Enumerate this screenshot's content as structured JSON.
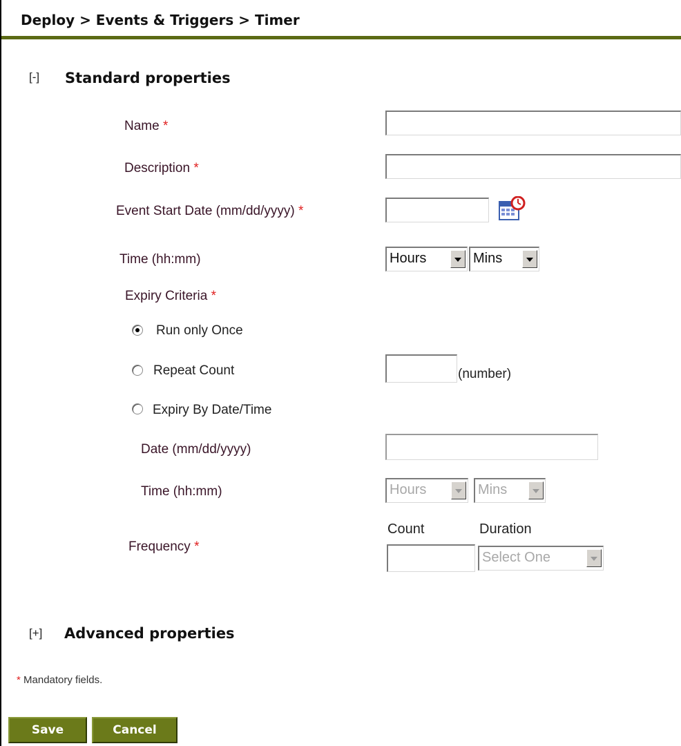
{
  "breadcrumb": "Deploy > Events & Triggers > Timer",
  "standard": {
    "toggle": "[-]",
    "title": "Standard properties",
    "name_label": "Name",
    "description_label": "Description",
    "start_date_label": "Event Start Date (mm/dd/yyyy)",
    "time_label": "Time  (hh:mm)",
    "hours_value": "Hours",
    "mins_value": "Mins",
    "expiry_label": "Expiry Criteria",
    "run_once_label": "Run only Once",
    "repeat_count_label": "Repeat Count",
    "number_hint": "(number)",
    "expiry_date_label": "Expiry By Date/Time",
    "date_label": "Date (mm/dd/yyyy)",
    "time2_label": "Time (hh:mm)",
    "hours2_value": "Hours",
    "mins2_value": "Mins",
    "count_header": "Count",
    "duration_header": "Duration",
    "frequency_label": "Frequency",
    "duration_value": "Select One",
    "required_marker": "*"
  },
  "advanced": {
    "toggle": "[+]",
    "title": "Advanced properties"
  },
  "footnote": {
    "marker": "*",
    "text": " Mandatory fields."
  },
  "buttons": {
    "save": "Save",
    "cancel": "Cancel"
  },
  "colors": {
    "accent": "#5b6a14",
    "button": "#6b7a1a",
    "required": "#e02020"
  }
}
